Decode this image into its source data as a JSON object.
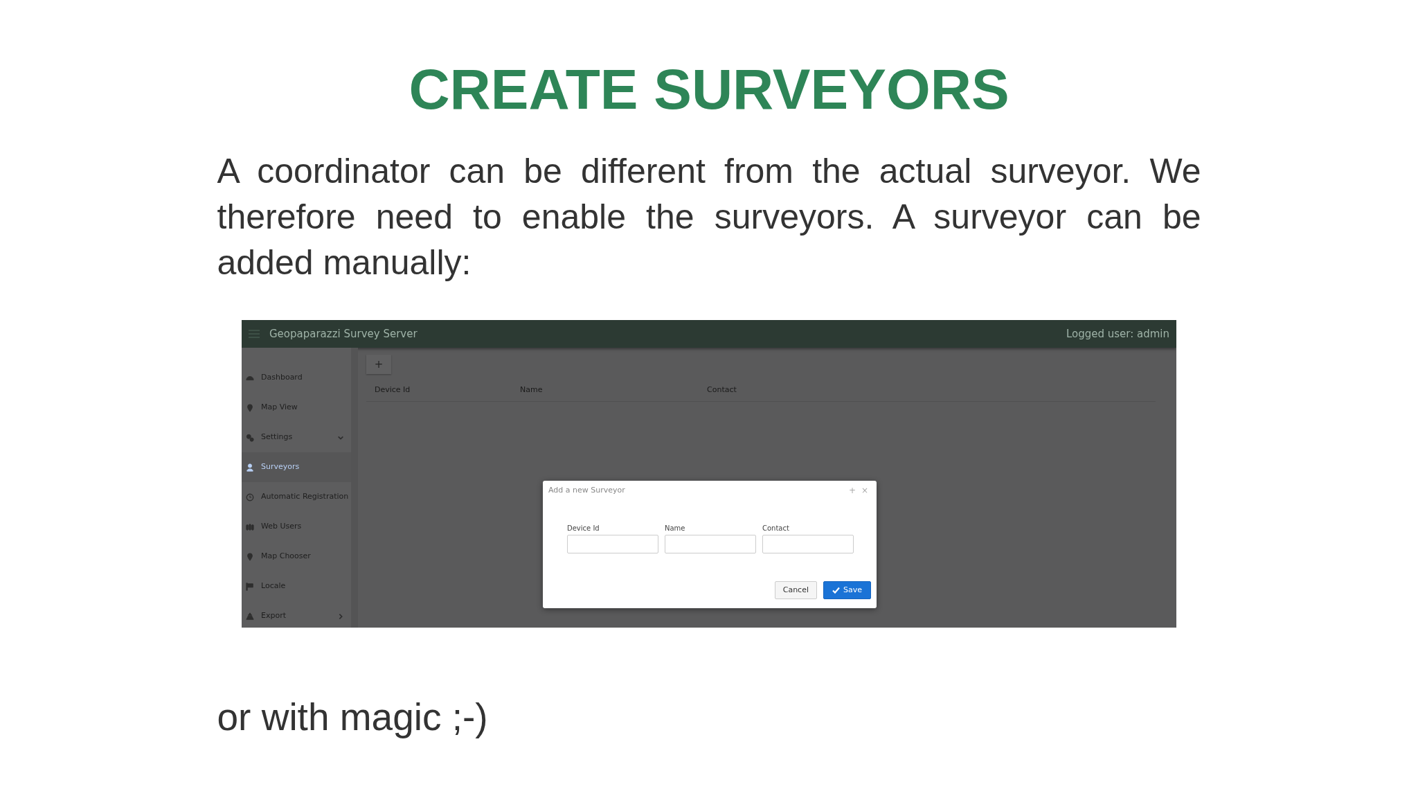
{
  "slide": {
    "title": "CREATE SURVEYORS",
    "paragraph": "A coordinator can be different from the actual surveyor. We therefore need to enable the surveyors. A surveyor can be added manually:",
    "closing": "or with magic ;-)"
  },
  "app": {
    "title": "Geopaparazzi Survey Server",
    "user": "Logged user: admin",
    "sidebar": [
      {
        "label": "Dashboard",
        "kind": "link",
        "selected": false
      },
      {
        "label": "Map View",
        "kind": "link",
        "selected": false
      },
      {
        "label": "Settings",
        "kind": "submenu",
        "expanded": true,
        "selected": false
      },
      {
        "label": "Surveyors",
        "kind": "link",
        "selected": true
      },
      {
        "label": "Automatic Registration",
        "kind": "link",
        "selected": false
      },
      {
        "label": "Web Users",
        "kind": "link",
        "selected": false
      },
      {
        "label": "Map Chooser",
        "kind": "link",
        "selected": false
      },
      {
        "label": "Locale",
        "kind": "link",
        "selected": false
      },
      {
        "label": "Export",
        "kind": "submenu",
        "expanded": false,
        "selected": false
      }
    ],
    "add_button": "+",
    "columns": [
      "Device Id",
      "Name",
      "Contact"
    ],
    "dialog": {
      "title": "Add a new Surveyor",
      "header_buttons": [
        "+",
        "×"
      ],
      "fields": [
        {
          "label": "Device Id"
        },
        {
          "label": "Name"
        },
        {
          "label": "Contact"
        }
      ],
      "cancel": "Cancel",
      "save": "Save"
    }
  }
}
